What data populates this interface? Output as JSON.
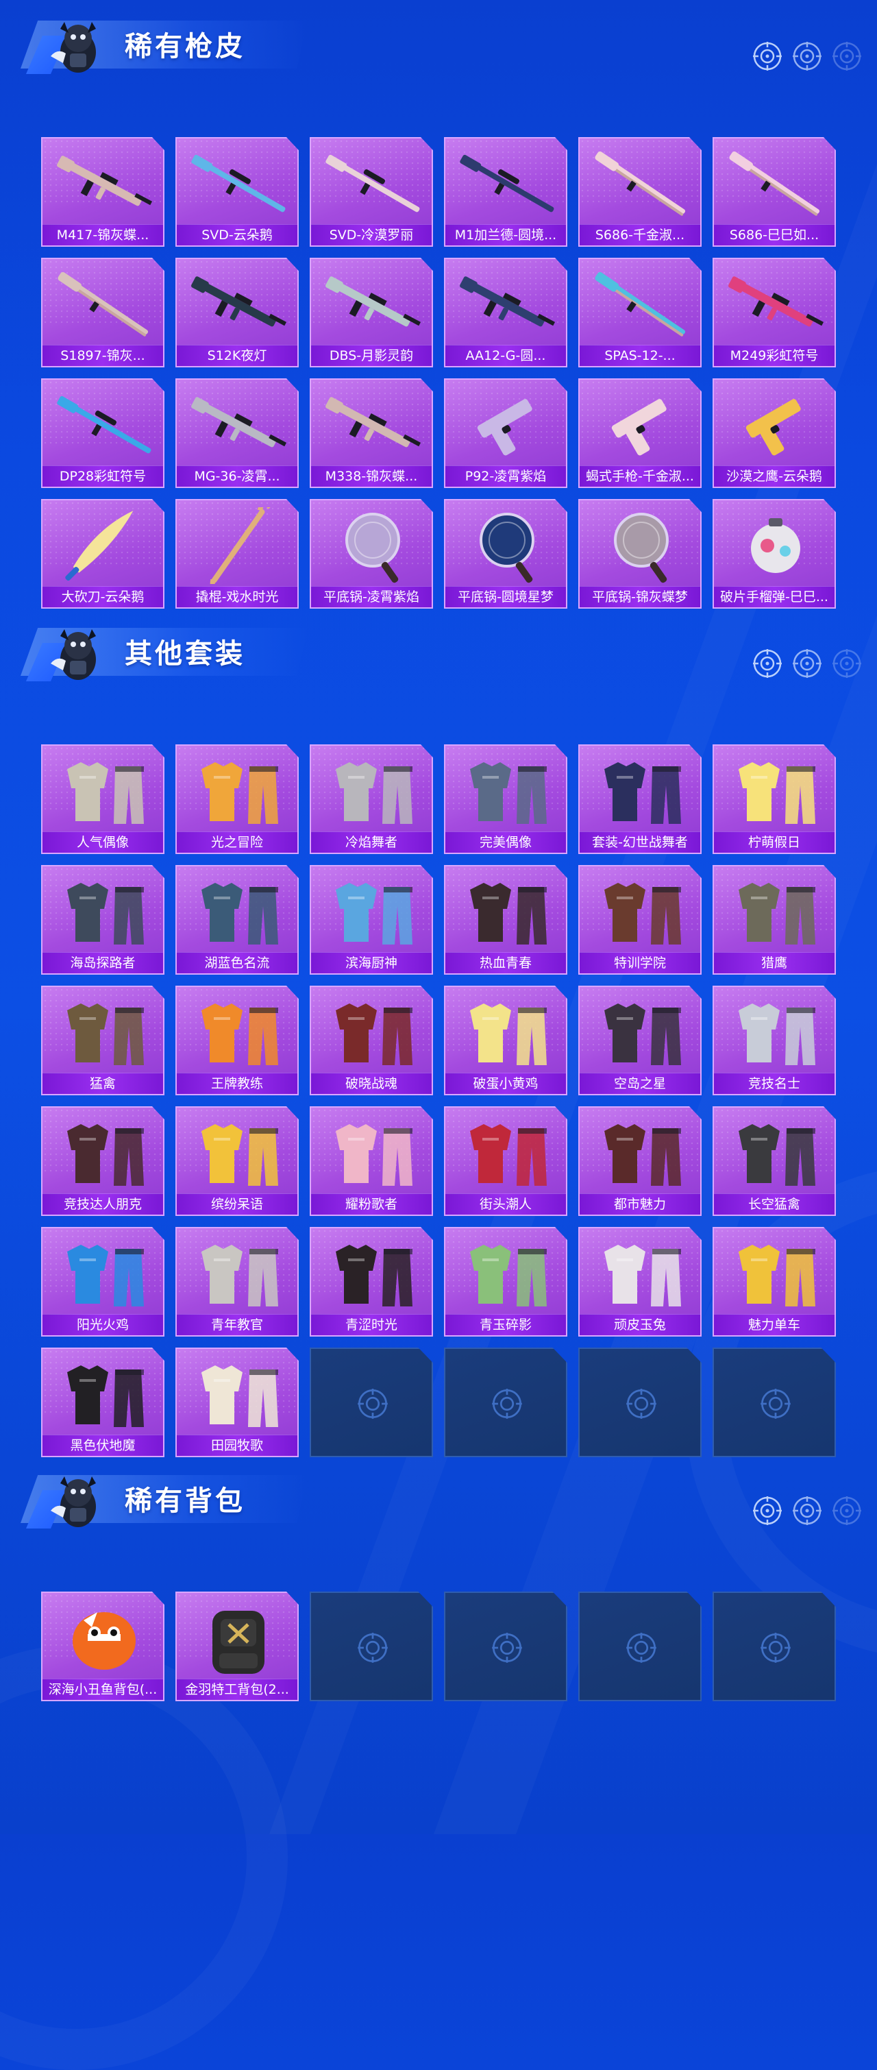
{
  "sections": [
    {
      "title": "稀有枪皮",
      "items": [
        {
          "label": "M417-锦灰蝶...",
          "kind": "rifle",
          "color": "#d7b9b3"
        },
        {
          "label": "SVD-云朵鹅",
          "kind": "sniper",
          "color": "#5fb6e8"
        },
        {
          "label": "SVD-冷漠罗丽",
          "kind": "sniper",
          "color": "#e9d2d8"
        },
        {
          "label": "M1加兰德-圆境...",
          "kind": "sniper",
          "color": "#2d3b6e"
        },
        {
          "label": "S686-千金淑...",
          "kind": "shotgun",
          "color": "#f1d3d8"
        },
        {
          "label": "S686-巳巳如...",
          "kind": "shotgun",
          "color": "#f2cfe0"
        },
        {
          "label": "S1897-锦灰...",
          "kind": "shotgun",
          "color": "#d9c2bc"
        },
        {
          "label": "S12K夜灯",
          "kind": "rifle",
          "color": "#273a4a"
        },
        {
          "label": "DBS-月影灵韵",
          "kind": "rifle",
          "color": "#b6c9c8"
        },
        {
          "label": "AA12-G-圆...",
          "kind": "rifle",
          "color": "#2e3f70"
        },
        {
          "label": "SPAS-12-...",
          "kind": "shotgun",
          "color": "#4fc0e0"
        },
        {
          "label": "M249彩虹符号",
          "kind": "rifle",
          "color": "#e0407e"
        },
        {
          "label": "DP28彩虹符号",
          "kind": "sniper",
          "color": "#3aa9e8"
        },
        {
          "label": "MG-36-凌霄...",
          "kind": "rifle",
          "color": "#b9b9c4"
        },
        {
          "label": "M338-锦灰蝶...",
          "kind": "rifle",
          "color": "#d2b8b2"
        },
        {
          "label": "P92-凌霄紫焰",
          "kind": "pistol",
          "color": "#c9b8e6"
        },
        {
          "label": "蝎式手枪-千金淑...",
          "kind": "pistol",
          "color": "#f1d6dc"
        },
        {
          "label": "沙漠之鹰-云朵鹅",
          "kind": "pistol",
          "color": "#f2c14b"
        },
        {
          "label": "大砍刀-云朵鹅",
          "kind": "blade",
          "color": "#f5e49a"
        },
        {
          "label": "撬棍-戏水时光",
          "kind": "crowbar",
          "color": "#e0b07a"
        },
        {
          "label": "平底锅-凌霄紫焰",
          "kind": "pan",
          "color": "#b7a6d6"
        },
        {
          "label": "平底锅-圆境星梦",
          "kind": "pan",
          "color": "#1f3a7a"
        },
        {
          "label": "平底锅-锦灰蝶梦",
          "kind": "pan",
          "color": "#a89aa8"
        },
        {
          "label": "破片手榴弹-巳巳...",
          "kind": "grenade",
          "color": "#e8e6ec"
        }
      ],
      "empty_slots": 0
    },
    {
      "title": "其他套装",
      "items": [
        {
          "label": "人气偶像",
          "kind": "outfit",
          "color": "#c9c3b4"
        },
        {
          "label": "光之冒险",
          "kind": "outfit",
          "color": "#f0a63a"
        },
        {
          "label": "冷焰舞者",
          "kind": "outfit",
          "color": "#b8b6bc"
        },
        {
          "label": "完美偶像",
          "kind": "outfit",
          "color": "#5a6a88"
        },
        {
          "label": "套装-幻世战舞者",
          "kind": "outfit",
          "color": "#2b2f5e"
        },
        {
          "label": "柠萌假日",
          "kind": "outfit",
          "color": "#f7e27a"
        },
        {
          "label": "海岛探路者",
          "kind": "outfit",
          "color": "#3e4a5c"
        },
        {
          "label": "湖蓝色名流",
          "kind": "outfit",
          "color": "#3b5b78"
        },
        {
          "label": "滨海厨神",
          "kind": "outfit",
          "color": "#5aa6e0"
        },
        {
          "label": "热血青春",
          "kind": "outfit",
          "color": "#3a2a2e"
        },
        {
          "label": "特训学院",
          "kind": "outfit",
          "color": "#6a3b2e"
        },
        {
          "label": "猎鹰",
          "kind": "outfit",
          "color": "#6d6a5a"
        },
        {
          "label": "猛禽",
          "kind": "outfit",
          "color": "#6e5a3e"
        },
        {
          "label": "王牌教练",
          "kind": "outfit",
          "color": "#f08a2a"
        },
        {
          "label": "破晓战魂",
          "kind": "outfit",
          "color": "#7a2a2a"
        },
        {
          "label": "破蛋小黄鸡",
          "kind": "outfit",
          "color": "#f3e38a"
        },
        {
          "label": "空岛之星",
          "kind": "outfit",
          "color": "#3a3240"
        },
        {
          "label": "竞技名士",
          "kind": "outfit",
          "color": "#c8ccd8"
        },
        {
          "label": "竞技达人朋克",
          "kind": "outfit",
          "color": "#4a2a30"
        },
        {
          "label": "缤纷呆语",
          "kind": "outfit",
          "color": "#f2c23a"
        },
        {
          "label": "耀粉歌者",
          "kind": "outfit",
          "color": "#f0b6c8"
        },
        {
          "label": "街头潮人",
          "kind": "outfit",
          "color": "#c0283a"
        },
        {
          "label": "都市魅力",
          "kind": "outfit",
          "color": "#5a2a2a"
        },
        {
          "label": "长空猛禽",
          "kind": "outfit",
          "color": "#3a3a3e"
        },
        {
          "label": "阳光火鸡",
          "kind": "outfit",
          "color": "#2a8ae0"
        },
        {
          "label": "青年教官",
          "kind": "outfit",
          "color": "#c9c6c2"
        },
        {
          "label": "青涩时光",
          "kind": "outfit",
          "color": "#2a2226"
        },
        {
          "label": "青玉碎影",
          "kind": "outfit",
          "color": "#8ac07a"
        },
        {
          "label": "顽皮玉兔",
          "kind": "outfit",
          "color": "#e8e2e8"
        },
        {
          "label": "魅力单车",
          "kind": "outfit",
          "color": "#f0c23a"
        },
        {
          "label": "黑色伏地魔",
          "kind": "outfit",
          "color": "#222024"
        },
        {
          "label": "田园牧歌",
          "kind": "outfit",
          "color": "#efe6d6"
        }
      ],
      "empty_slots": 4
    },
    {
      "title": "稀有背包",
      "items": [
        {
          "label": "深海小丑鱼背包(...",
          "kind": "backpack-fish",
          "color": "#f26a1e"
        },
        {
          "label": "金羽特工背包(2...",
          "kind": "backpack",
          "color": "#2a2a2a"
        }
      ],
      "empty_slots": 4
    }
  ]
}
